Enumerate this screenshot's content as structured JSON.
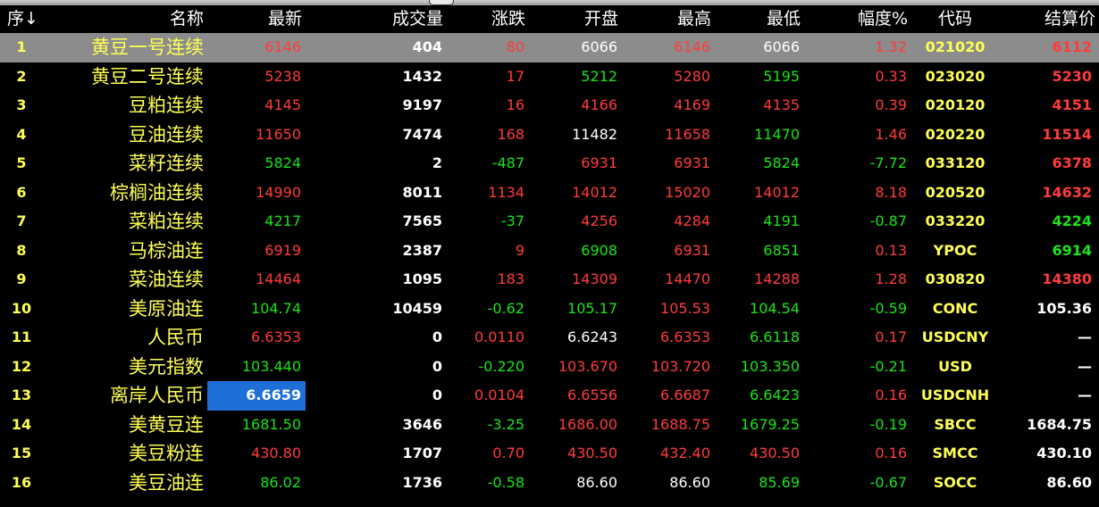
{
  "header": {
    "idx_label": "序↓",
    "name": "名称",
    "latest": "最新",
    "volume": "成交量",
    "change": "涨跌",
    "open": "开盘",
    "high": "最高",
    "low": "最低",
    "pct": "幅度%",
    "code": "代码",
    "settle": "结算价"
  },
  "colors": {
    "up": "#ff3b3b",
    "down": "#19e419",
    "flat": "#ffffff",
    "label": "#ffff55",
    "background": "#000000",
    "selected_row": "#8c8c8c",
    "highlight_cell": "#1e6fd8"
  },
  "rows": [
    {
      "idx": "1",
      "name": "黄豆一号连续",
      "latest": "6146",
      "latest_dir": "up",
      "volume": "404",
      "change": "80",
      "change_dir": "up",
      "open": "6066",
      "open_dir": "flat",
      "high": "6146",
      "high_dir": "up",
      "low": "6066",
      "low_dir": "flat",
      "pct": "1.32",
      "pct_dir": "up",
      "code": "021020",
      "settle": "6112",
      "settle_dir": "up",
      "selected": true
    },
    {
      "idx": "2",
      "name": "黄豆二号连续",
      "latest": "5238",
      "latest_dir": "up",
      "volume": "1432",
      "change": "17",
      "change_dir": "up",
      "open": "5212",
      "open_dir": "down",
      "high": "5280",
      "high_dir": "up",
      "low": "5195",
      "low_dir": "down",
      "pct": "0.33",
      "pct_dir": "up",
      "code": "023020",
      "settle": "5230",
      "settle_dir": "up"
    },
    {
      "idx": "3",
      "name": "豆粕连续",
      "latest": "4145",
      "latest_dir": "up",
      "volume": "9197",
      "change": "16",
      "change_dir": "up",
      "open": "4166",
      "open_dir": "up",
      "high": "4169",
      "high_dir": "up",
      "low": "4135",
      "low_dir": "up",
      "pct": "0.39",
      "pct_dir": "up",
      "code": "020120",
      "settle": "4151",
      "settle_dir": "up"
    },
    {
      "idx": "4",
      "name": "豆油连续",
      "latest": "11650",
      "latest_dir": "up",
      "volume": "7474",
      "change": "168",
      "change_dir": "up",
      "open": "11482",
      "open_dir": "flat",
      "high": "11658",
      "high_dir": "up",
      "low": "11470",
      "low_dir": "down",
      "pct": "1.46",
      "pct_dir": "up",
      "code": "020220",
      "settle": "11514",
      "settle_dir": "up"
    },
    {
      "idx": "5",
      "name": "菜籽连续",
      "latest": "5824",
      "latest_dir": "down",
      "volume": "2",
      "change": "-487",
      "change_dir": "down",
      "open": "6931",
      "open_dir": "up",
      "high": "6931",
      "high_dir": "up",
      "low": "5824",
      "low_dir": "down",
      "pct": "-7.72",
      "pct_dir": "down",
      "code": "033120",
      "settle": "6378",
      "settle_dir": "up"
    },
    {
      "idx": "6",
      "name": "棕榈油连续",
      "latest": "14990",
      "latest_dir": "up",
      "volume": "8011",
      "change": "1134",
      "change_dir": "up",
      "open": "14012",
      "open_dir": "up",
      "high": "15020",
      "high_dir": "up",
      "low": "14012",
      "low_dir": "up",
      "pct": "8.18",
      "pct_dir": "up",
      "code": "020520",
      "settle": "14632",
      "settle_dir": "up"
    },
    {
      "idx": "7",
      "name": "菜粕连续",
      "latest": "4217",
      "latest_dir": "down",
      "volume": "7565",
      "change": "-37",
      "change_dir": "down",
      "open": "4256",
      "open_dir": "up",
      "high": "4284",
      "high_dir": "up",
      "low": "4191",
      "low_dir": "down",
      "pct": "-0.87",
      "pct_dir": "down",
      "code": "033220",
      "settle": "4224",
      "settle_dir": "down"
    },
    {
      "idx": "8",
      "name": "马棕油连",
      "latest": "6919",
      "latest_dir": "up",
      "volume": "2387",
      "change": "9",
      "change_dir": "up",
      "open": "6908",
      "open_dir": "down",
      "high": "6931",
      "high_dir": "up",
      "low": "6851",
      "low_dir": "down",
      "pct": "0.13",
      "pct_dir": "up",
      "code": "YPOC",
      "settle": "6914",
      "settle_dir": "down"
    },
    {
      "idx": "9",
      "name": "菜油连续",
      "latest": "14464",
      "latest_dir": "up",
      "volume": "1095",
      "change": "183",
      "change_dir": "up",
      "open": "14309",
      "open_dir": "up",
      "high": "14470",
      "high_dir": "up",
      "low": "14288",
      "low_dir": "up",
      "pct": "1.28",
      "pct_dir": "up",
      "code": "030820",
      "settle": "14380",
      "settle_dir": "up"
    },
    {
      "idx": "10",
      "name": "美原油连",
      "latest": "104.74",
      "latest_dir": "down",
      "volume": "10459",
      "change": "-0.62",
      "change_dir": "down",
      "open": "105.17",
      "open_dir": "down",
      "high": "105.53",
      "high_dir": "up",
      "low": "104.54",
      "low_dir": "down",
      "pct": "-0.59",
      "pct_dir": "down",
      "code": "CONC",
      "settle": "105.36",
      "settle_dir": "flat"
    },
    {
      "idx": "11",
      "name": "人民币",
      "latest": "6.6353",
      "latest_dir": "up",
      "volume": "0",
      "change": "0.0110",
      "change_dir": "up",
      "open": "6.6243",
      "open_dir": "flat",
      "high": "6.6353",
      "high_dir": "up",
      "low": "6.6118",
      "low_dir": "down",
      "pct": "0.17",
      "pct_dir": "up",
      "code": "USDCNY",
      "settle": "—",
      "settle_dir": "flat"
    },
    {
      "idx": "12",
      "name": "美元指数",
      "latest": "103.440",
      "latest_dir": "down",
      "volume": "0",
      "change": "-0.220",
      "change_dir": "down",
      "open": "103.670",
      "open_dir": "up",
      "high": "103.720",
      "high_dir": "up",
      "low": "103.350",
      "low_dir": "down",
      "pct": "-0.21",
      "pct_dir": "down",
      "code": "USD",
      "settle": "—",
      "settle_dir": "flat"
    },
    {
      "idx": "13",
      "name": "离岸人民币",
      "latest": "6.6659",
      "latest_dir": "flat",
      "latest_highlight": true,
      "volume": "0",
      "change": "0.0104",
      "change_dir": "up",
      "open": "6.6556",
      "open_dir": "up",
      "high": "6.6687",
      "high_dir": "up",
      "low": "6.6423",
      "low_dir": "down",
      "pct": "0.16",
      "pct_dir": "up",
      "code": "USDCNH",
      "settle": "—",
      "settle_dir": "flat"
    },
    {
      "idx": "14",
      "name": "美黄豆连",
      "latest": "1681.50",
      "latest_dir": "down",
      "volume": "3646",
      "change": "-3.25",
      "change_dir": "down",
      "open": "1686.00",
      "open_dir": "up",
      "high": "1688.75",
      "high_dir": "up",
      "low": "1679.25",
      "low_dir": "down",
      "pct": "-0.19",
      "pct_dir": "down",
      "code": "SBCC",
      "settle": "1684.75",
      "settle_dir": "flat"
    },
    {
      "idx": "15",
      "name": "美豆粉连",
      "latest": "430.80",
      "latest_dir": "up",
      "volume": "1707",
      "change": "0.70",
      "change_dir": "up",
      "open": "430.50",
      "open_dir": "up",
      "high": "432.40",
      "high_dir": "up",
      "low": "430.50",
      "low_dir": "up",
      "pct": "0.16",
      "pct_dir": "up",
      "code": "SMCC",
      "settle": "430.10",
      "settle_dir": "flat"
    },
    {
      "idx": "16",
      "name": "美豆油连",
      "latest": "86.02",
      "latest_dir": "down",
      "volume": "1736",
      "change": "-0.58",
      "change_dir": "down",
      "open": "86.60",
      "open_dir": "flat",
      "high": "86.60",
      "high_dir": "flat",
      "low": "85.69",
      "low_dir": "down",
      "pct": "-0.67",
      "pct_dir": "down",
      "code": "SOCC",
      "settle": "86.60",
      "settle_dir": "flat"
    }
  ]
}
